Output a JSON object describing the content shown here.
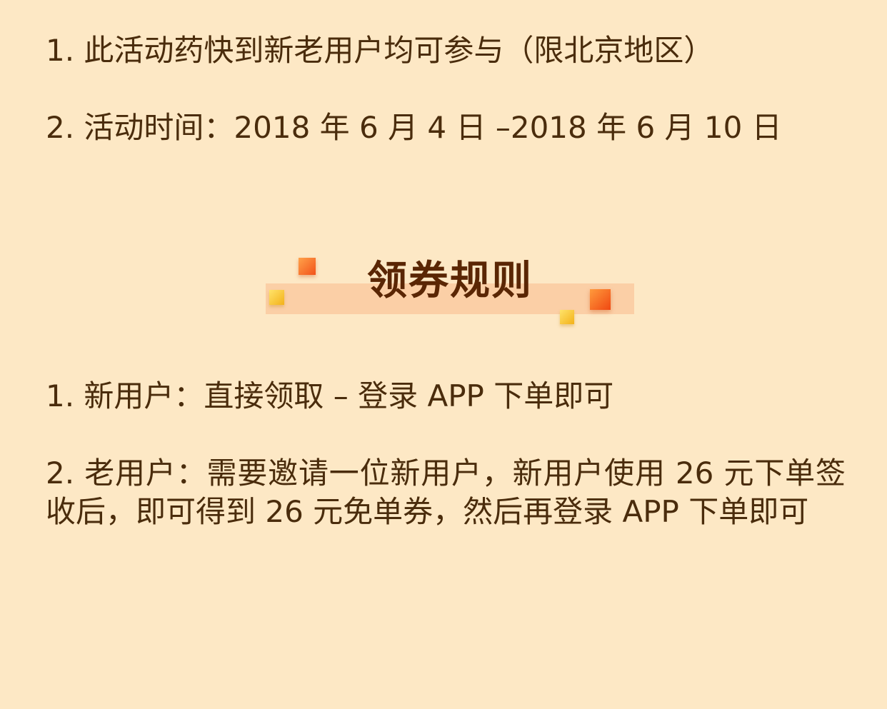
{
  "activity_rules": [
    "1. 此活动药快到新老用户均可参与（限北京地区）",
    "2. 活动时间：2018 年 6 月 4 日 –2018 年 6 月 10 日"
  ],
  "section_title": "领券规则",
  "coupon_rules": [
    "1. 新用户：直接领取 – 登录 APP 下单即可",
    "2. 老用户：需要邀请一位新用户，新用户使用 26 元下单签收后，即可得到 26 元免单券，然后再登录 APP 下单即可"
  ],
  "colors": {
    "background": "#fde8c5",
    "text": "#4a2c0c",
    "title": "#5a2604",
    "title_band": "#fbcfa6",
    "accent_orange": "#f2521a",
    "accent_yellow": "#f3b11a"
  }
}
